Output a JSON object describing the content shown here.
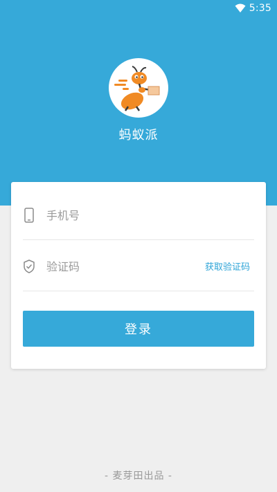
{
  "status_bar": {
    "time": "5:35"
  },
  "app": {
    "name": "蚂蚁派"
  },
  "icons": {
    "wifi": "wifi-icon",
    "logo": "ant-logo-icon",
    "phone": "phone-icon",
    "shield": "shield-icon"
  },
  "form": {
    "phone_placeholder": "手机号",
    "code_placeholder": "验证码",
    "get_code_label": "获取验证码",
    "login_label": "登录"
  },
  "footer": {
    "text": "- 麦芽田出品 -"
  },
  "colors": {
    "primary": "#36a9d9",
    "background": "#efefef",
    "logo_orange": "#f08a24"
  }
}
